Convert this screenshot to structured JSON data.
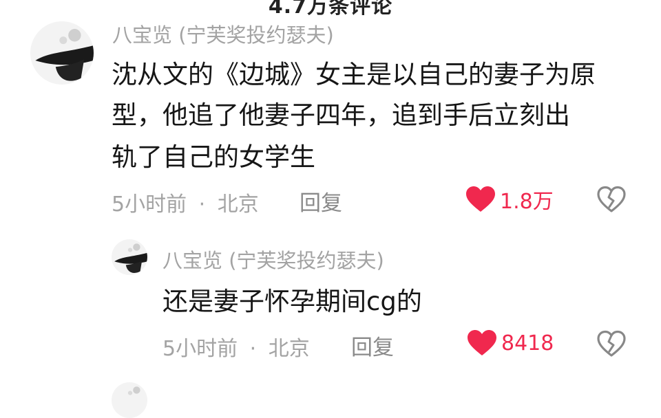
{
  "header": {
    "title": "4.7万条评论"
  },
  "comments": [
    {
      "author": "八宝览 (宁芙奖投约瑟夫)",
      "lines": [
        "沈从文的《边城》女主是以自己的妻子为原",
        "型，他追了他妻子四年，追到手后立刻出",
        "轨了自己的女学生"
      ],
      "time": "5小时前",
      "dot": "·",
      "location": "北京",
      "reply_label": "回复",
      "likes": "1.8万"
    }
  ],
  "replies": [
    {
      "author": "八宝览 (宁芙奖投约瑟夫)",
      "text": "还是妻子怀孕期间cg的",
      "time": "5小时前",
      "dot": "·",
      "location": "北京",
      "reply_label": "回复",
      "likes": "8418"
    }
  ],
  "colors": {
    "like": "#f0284e",
    "meta": "#a3a3a3",
    "text": "#161616"
  },
  "icons": {
    "like": "heart-icon",
    "dislike": "broken-heart-icon"
  }
}
